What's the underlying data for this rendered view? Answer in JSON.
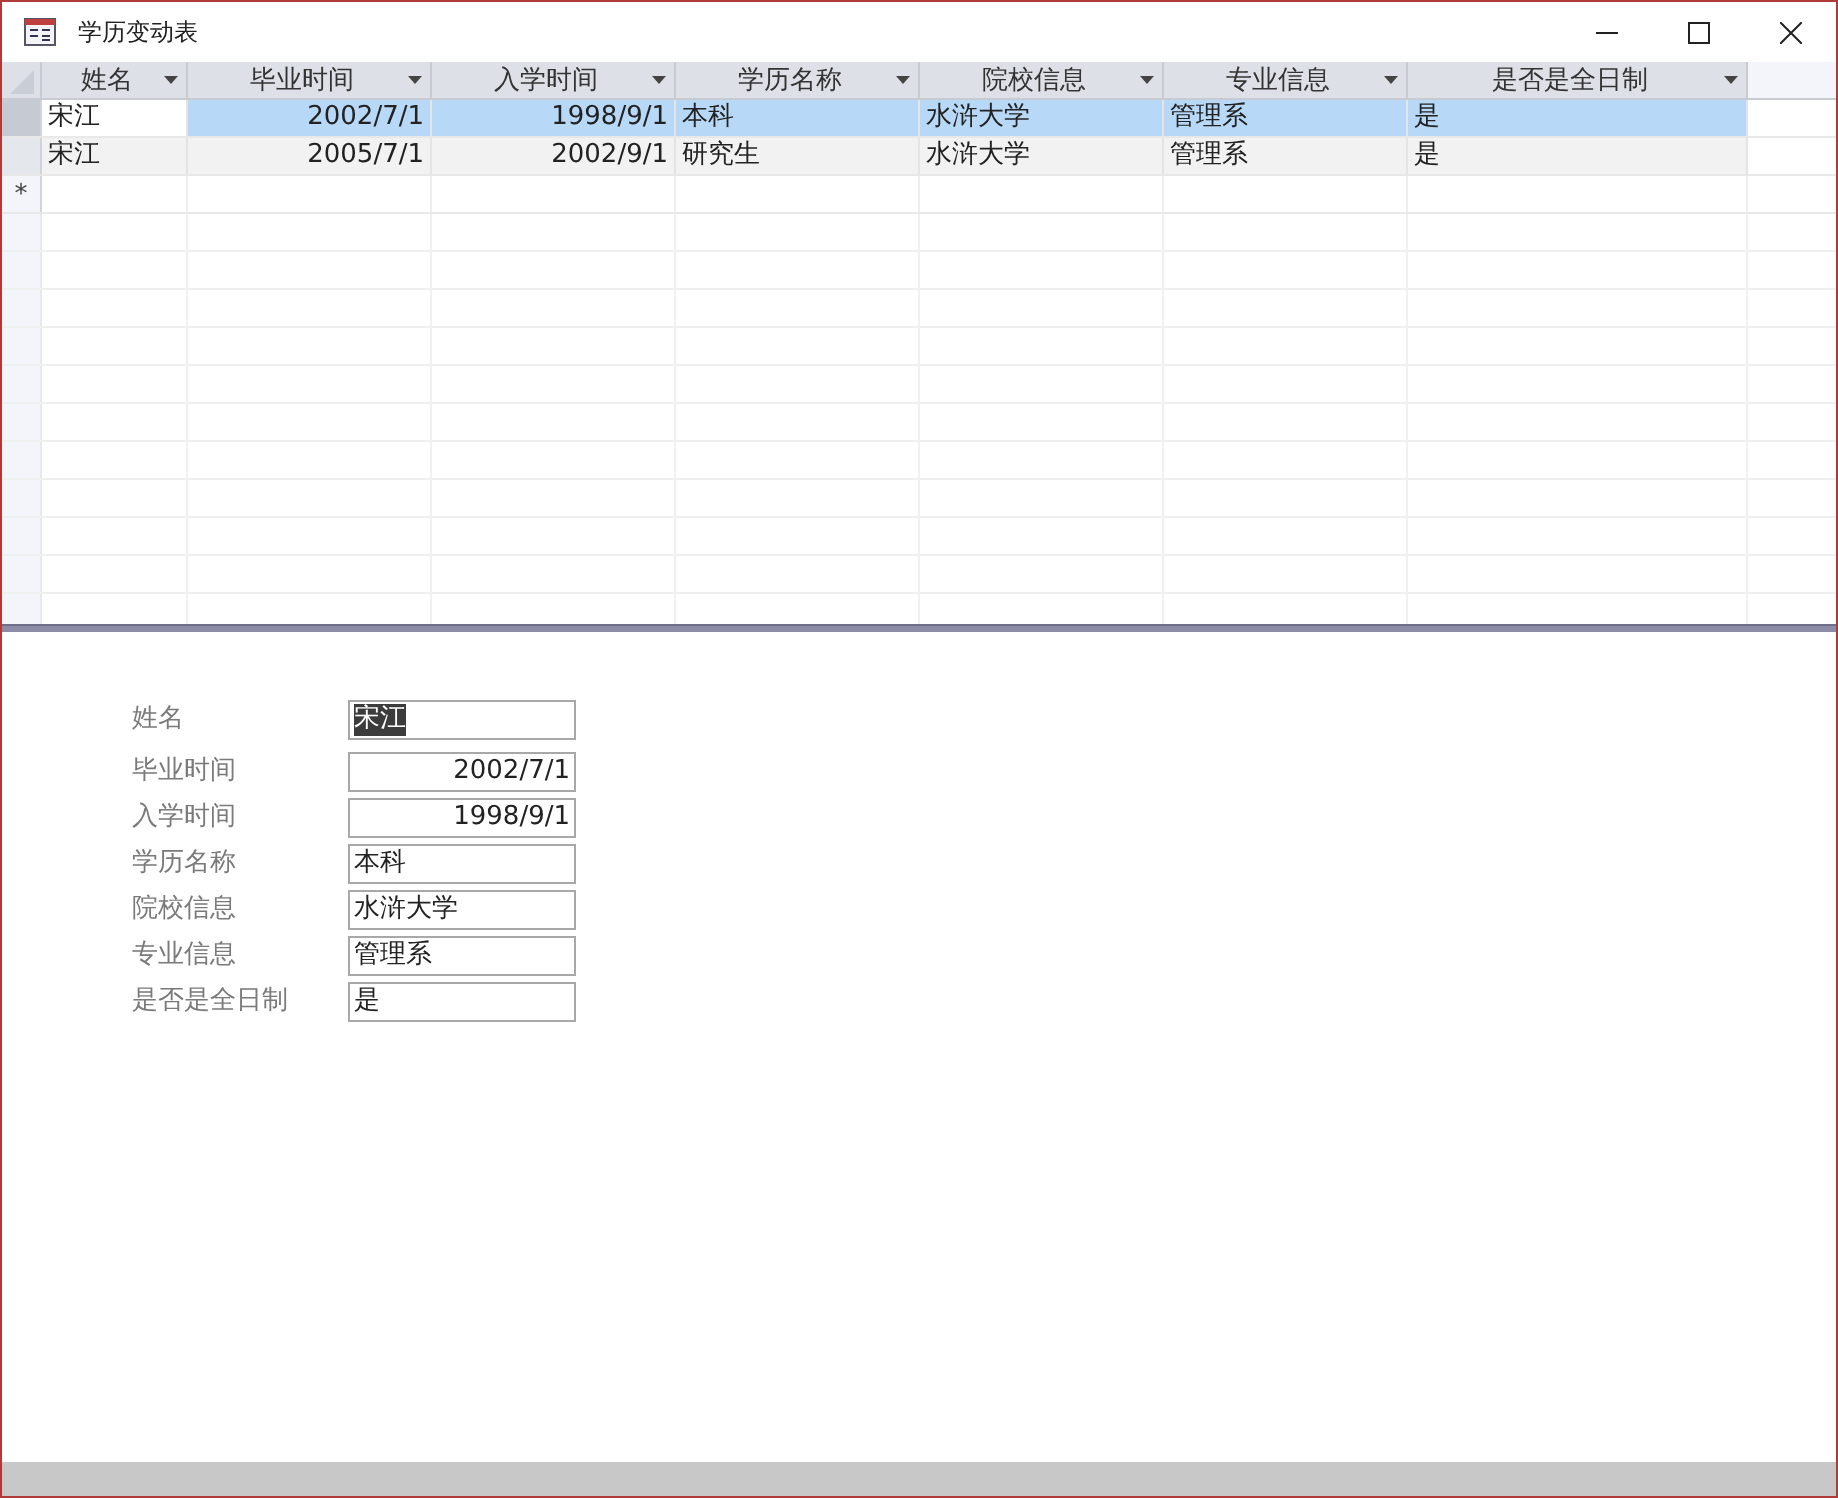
{
  "window": {
    "title": "学历变动表"
  },
  "datasheet": {
    "columns": [
      {
        "label": "姓名",
        "kind": "text"
      },
      {
        "label": "毕业时间",
        "kind": "date"
      },
      {
        "label": "入学时间",
        "kind": "date"
      },
      {
        "label": "学历名称",
        "kind": "text"
      },
      {
        "label": "院校信息",
        "kind": "text"
      },
      {
        "label": "专业信息",
        "kind": "text"
      },
      {
        "label": "是否是全日制",
        "kind": "text"
      }
    ],
    "rows": [
      {
        "selected": true,
        "cells": [
          {
            "text": "宋江",
            "focused": true
          },
          {
            "text": "2002/7/1",
            "focused": false
          },
          {
            "text": "1998/9/1",
            "focused": false
          },
          {
            "text": "本科",
            "focused": false
          },
          {
            "text": "水浒大学",
            "focused": false
          },
          {
            "text": "管理系",
            "focused": false
          },
          {
            "text": "是",
            "focused": false
          }
        ]
      },
      {
        "selected": false,
        "cells": [
          {
            "text": "宋江",
            "focused": false
          },
          {
            "text": "2005/7/1",
            "focused": false
          },
          {
            "text": "2002/9/1",
            "focused": false
          },
          {
            "text": "研究生",
            "focused": false
          },
          {
            "text": "水浒大学",
            "focused": false
          },
          {
            "text": "管理系",
            "focused": false
          },
          {
            "text": "是",
            "focused": false
          }
        ]
      }
    ],
    "new_row": {
      "marker": "*"
    }
  },
  "form": {
    "fields": [
      {
        "label": "姓名",
        "value": "宋江",
        "kind": "text",
        "highlighted": true
      },
      {
        "label": "毕业时间",
        "value": "2002/7/1",
        "kind": "date",
        "highlighted": false
      },
      {
        "label": "入学时间",
        "value": "1998/9/1",
        "kind": "date",
        "highlighted": false
      },
      {
        "label": "学历名称",
        "value": "本科",
        "kind": "text",
        "highlighted": false
      },
      {
        "label": "院校信息",
        "value": "水浒大学",
        "kind": "text",
        "highlighted": false
      },
      {
        "label": "专业信息",
        "value": "管理系",
        "kind": "text",
        "highlighted": false
      },
      {
        "label": "是否是全日制",
        "value": "是",
        "kind": "text",
        "highlighted": false
      }
    ]
  }
}
